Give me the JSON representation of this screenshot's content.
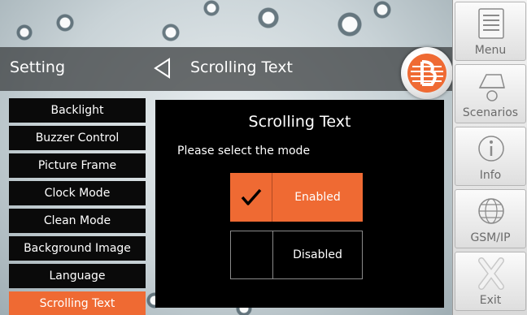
{
  "header": {
    "section_label": "Setting",
    "page_title": "Scrolling Text"
  },
  "side_menu": {
    "items": [
      {
        "label": "Backlight",
        "active": false
      },
      {
        "label": "Buzzer Control",
        "active": false
      },
      {
        "label": "Picture Frame",
        "active": false
      },
      {
        "label": "Clock Mode",
        "active": false
      },
      {
        "label": "Clean Mode",
        "active": false
      },
      {
        "label": "Background Image",
        "active": false
      },
      {
        "label": "Language",
        "active": false
      },
      {
        "label": "Scrolling Text",
        "active": true
      }
    ]
  },
  "dialog": {
    "title": "Scrolling Text",
    "prompt": "Please select the mode",
    "options": [
      {
        "label": "Enabled",
        "selected": true,
        "check_glyph": "✔"
      },
      {
        "label": "Disabled",
        "selected": false,
        "check_glyph": ""
      }
    ]
  },
  "right_panel": {
    "buttons": [
      {
        "label": "Menu",
        "icon": "menu-list-icon"
      },
      {
        "label": "Scenarios",
        "icon": "scenarios-icon"
      },
      {
        "label": "Info",
        "icon": "info-icon"
      },
      {
        "label": "GSM/IP",
        "icon": "globe-icon"
      },
      {
        "label": "Exit",
        "icon": "exit-x-icon"
      }
    ]
  },
  "colors": {
    "accent": "#ef6a33",
    "panel_dark": "#000000",
    "right_panel_text": "#6b6b6b"
  }
}
